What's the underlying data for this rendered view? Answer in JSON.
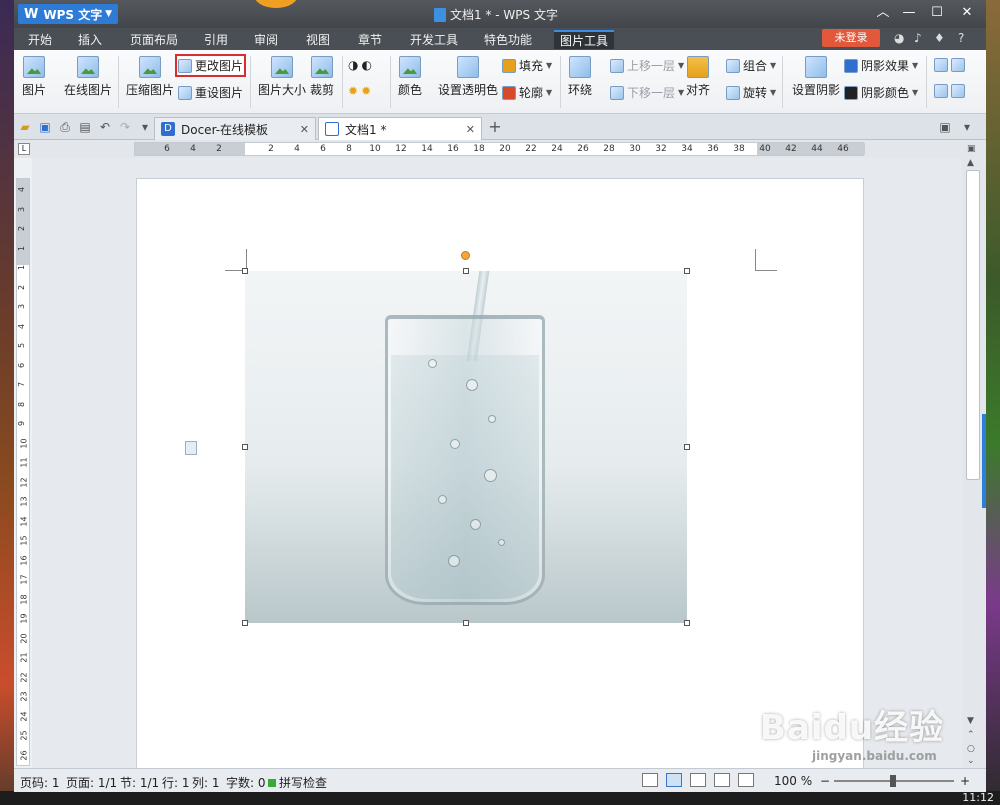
{
  "app": {
    "name": "WPS 文字",
    "window_title": "文档1 * - WPS 文字"
  },
  "menu": {
    "tabs": [
      "开始",
      "插入",
      "页面布局",
      "引用",
      "审阅",
      "视图",
      "章节",
      "开发工具",
      "特色功能",
      "图片工具"
    ],
    "active_tab": "图片工具",
    "login": "未登录",
    "help": "?"
  },
  "ribbon": {
    "picture": "图片",
    "online_picture": "在线图片",
    "change_picture": "更改图片",
    "compress_picture": "压缩图片",
    "reset_picture": "重设图片",
    "picture_size": "图片大小",
    "crop": "裁剪",
    "color": "颜色",
    "set_transparent": "设置透明色",
    "fill": "填充",
    "outline": "轮廓",
    "wrap": "环绕",
    "bring_forward": "上移一层",
    "send_backward": "下移一层",
    "align": "对齐",
    "group": "组合",
    "rotate": "旋转",
    "set_shadow": "设置阴影",
    "shadow_effect": "阴影效果",
    "shadow_color": "阴影颜色"
  },
  "doc_tabs": [
    {
      "label": "Docer-在线模板"
    },
    {
      "label": "文档1 *"
    }
  ],
  "ruler": {
    "h_ticks": [
      "6",
      "4",
      "2",
      "2",
      "4",
      "6",
      "8",
      "10",
      "12",
      "14",
      "16",
      "18",
      "20",
      "22",
      "24",
      "26",
      "28",
      "30",
      "32",
      "34",
      "36",
      "38",
      "40",
      "42",
      "44",
      "46"
    ],
    "v_ticks": [
      "4",
      "3",
      "2",
      "1",
      "1",
      "2",
      "3",
      "4",
      "5",
      "6",
      "7",
      "8",
      "9",
      "10",
      "11",
      "12",
      "13",
      "14",
      "15",
      "16",
      "17",
      "18",
      "19",
      "20",
      "21",
      "22",
      "23",
      "24",
      "25",
      "26"
    ]
  },
  "status": {
    "page_num": "页码: 1",
    "pages": "页面: 1/1",
    "section": "节: 1/1",
    "row": "行: 1",
    "col": "列: 1",
    "word_count": "字数: 0",
    "spell_check": "拼写检查",
    "zoom": "100 %"
  },
  "clock": "11:12",
  "watermark": {
    "text": "Baidu经验",
    "url": "jingyan.baidu.com"
  },
  "colors": {
    "accent": "#2e7bd6",
    "login": "#e2583b",
    "highlight_box": "#d32f2f"
  }
}
